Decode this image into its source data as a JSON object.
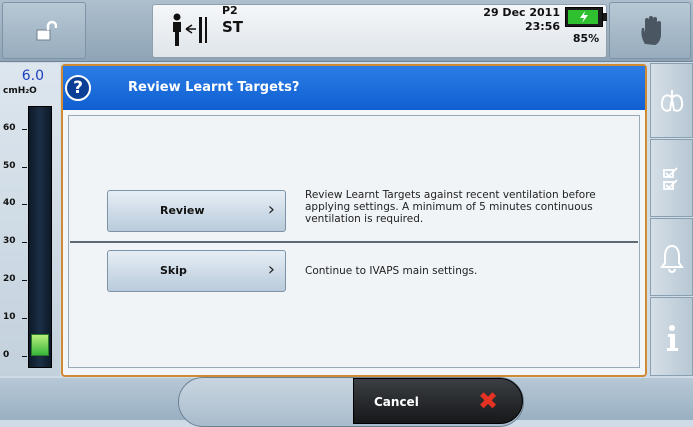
{
  "top_bar": {
    "mode_code": "P2",
    "mode_name": "ST",
    "date": "29 Dec 2011",
    "time": "23:56",
    "battery_percent": "85%"
  },
  "gauge": {
    "value": "6.0",
    "unit": "cmH₂O",
    "ticks": [
      "60",
      "50",
      "40",
      "30",
      "20",
      "10",
      "0"
    ],
    "fill_level": 0.1
  },
  "right_nav": {
    "items": [
      "lungs-icon",
      "checklist-icon",
      "alarm-bell-icon",
      "info-icon"
    ]
  },
  "dialog": {
    "title": "Review Learnt Targets?",
    "options": [
      {
        "label": "Review",
        "description": "Review Learnt Targets against recent ventilation before applying settings. A minimum of 5 minutes continuous ventilation is required."
      },
      {
        "label": "Skip",
        "description": "Continue to IVAPS main settings."
      }
    ]
  },
  "bottom_bar": {
    "cancel_label": "Cancel"
  },
  "colors": {
    "header_blue": "#1a6ddd",
    "dialog_border": "#d08a33",
    "gauge_value": "#1b3fbf",
    "battery_green": "#2ec02e",
    "cancel_x_red": "#e53222"
  }
}
